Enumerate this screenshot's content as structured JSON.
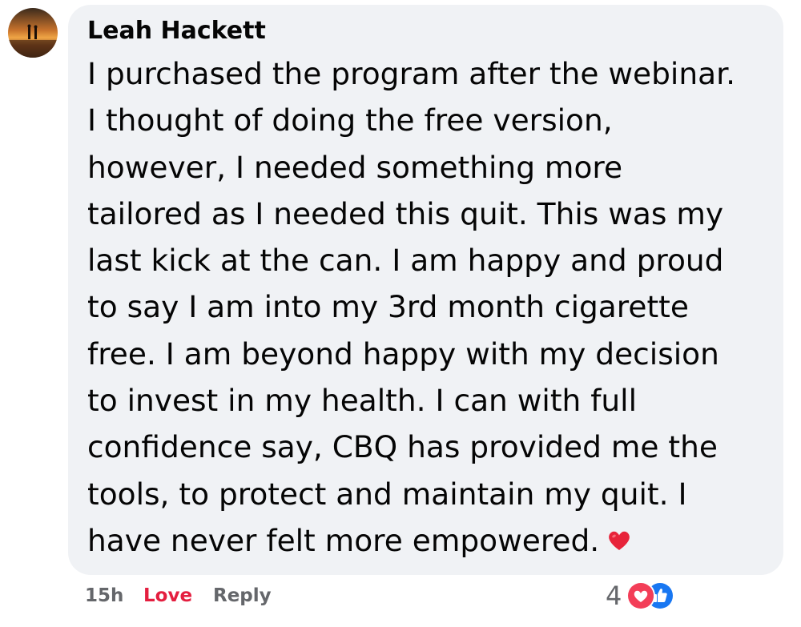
{
  "comment": {
    "author": "Leah Hackett",
    "avatar_icon": "sunset-silhouette-avatar",
    "text_lines": [
      "I purchased the program after the webinar.",
      "I thought of doing the free version,",
      "however, I needed something more",
      "tailored as I needed this quit. This was my",
      "last kick at the can. I am happy and proud",
      "to say I am into my 3rd month cigarette",
      "free. I am beyond happy with my decision",
      "to invest in my health. I can with full",
      "confidence say, CBQ has provided me the",
      "tools, to protect and maintain my quit. I",
      "have never felt more empowered."
    ],
    "emoji": "red-heart-emoji",
    "bubble_color": "#f0f2f5"
  },
  "actions": {
    "time": "15h",
    "love_label": "Love",
    "reply_label": "Reply",
    "love_color": "#e41e3f"
  },
  "reactions": {
    "count": "4",
    "icons": [
      "love-reaction-icon",
      "like-reaction-icon"
    ]
  }
}
